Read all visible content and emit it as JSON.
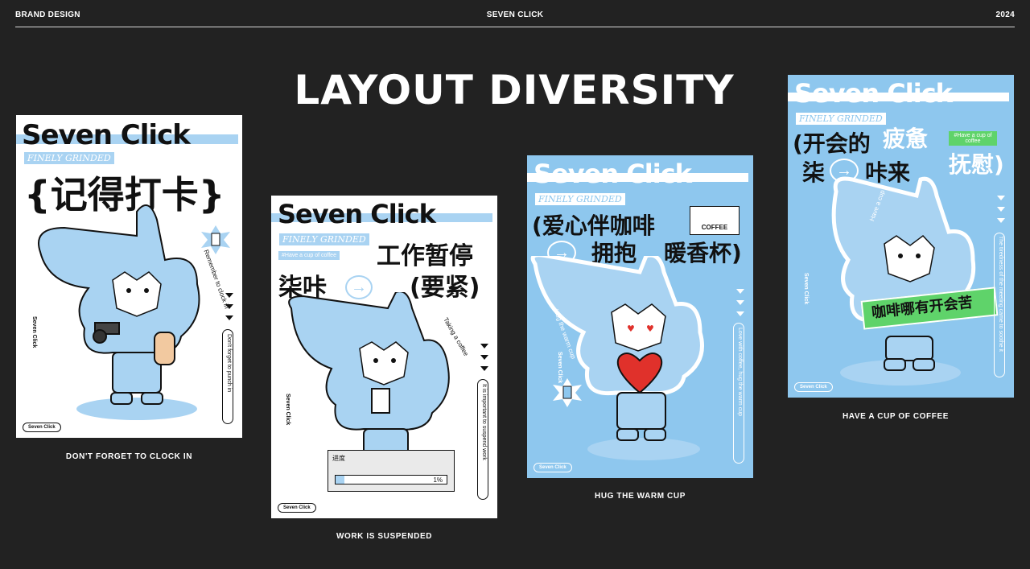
{
  "header": {
    "left": "BRAND DESIGN",
    "center": "SEVEN CLICK",
    "right": "2024"
  },
  "headline": "LAYOUT DIVERSITY",
  "posters": {
    "p1": {
      "brand": "Seven Click",
      "sub": "FINELY GRINDED",
      "title": "{记得打卡}",
      "side_text": "Remember to clock in",
      "vertical_text": "Don't forget to punch in",
      "side_logo": "Seven Click",
      "pill": "Seven Click",
      "caption": "DON'T FORGET TO CLOCK IN"
    },
    "p2": {
      "brand": "Seven Click",
      "sub": "FINELY GRINDED",
      "tag": "#Have a cup of coffee",
      "line1": "工作暂停",
      "line2a": "柒咔",
      "line2b": "(要紧)",
      "side_text": "Taking a coffee",
      "vertical_text": "It is important to suspend work",
      "side_logo": "Seven Click",
      "progress_label": "进度",
      "progress_value": "1%",
      "progress_fraction": 0.01,
      "pill": "Seven Click",
      "caption": "WORK IS SUSPENDED"
    },
    "p3": {
      "brand": "Seven Click",
      "sub": "FINELY GRINDED",
      "sign": "COFFEE",
      "line1": "(爱心伴咖啡",
      "line2a": "拥抱",
      "line2b": "暖香杯)",
      "side_text": "Hug the warm cup",
      "vertical_text": "Love with coffee, hug the warm cup",
      "side_logo": "Seven Click",
      "pill": "Seven Click",
      "caption": "HUG THE WARM CUP"
    },
    "p4": {
      "brand": "Seven Click",
      "sub": "FINELY GRINDED",
      "tag": "#Have a cup of coffee",
      "line1a": "(开会的",
      "line1b": "疲惫",
      "line2a": "柒",
      "line2b": "咔来",
      "line2c": "抚慰)",
      "side_text": "Have a cup",
      "vertical_text": "The tiredness of the meeting came to soothe it",
      "side_logo": "Seven Click",
      "banner": "咖啡哪有开会苦",
      "pill": "Seven Click",
      "caption": "HAVE A CUP OF COFFEE"
    }
  },
  "colors": {
    "background": "#222222",
    "mascot_blue": "#a9d3f2",
    "poster_blue": "#8ec7ee",
    "accent_green": "#5fd36a",
    "ink": "#111111"
  }
}
